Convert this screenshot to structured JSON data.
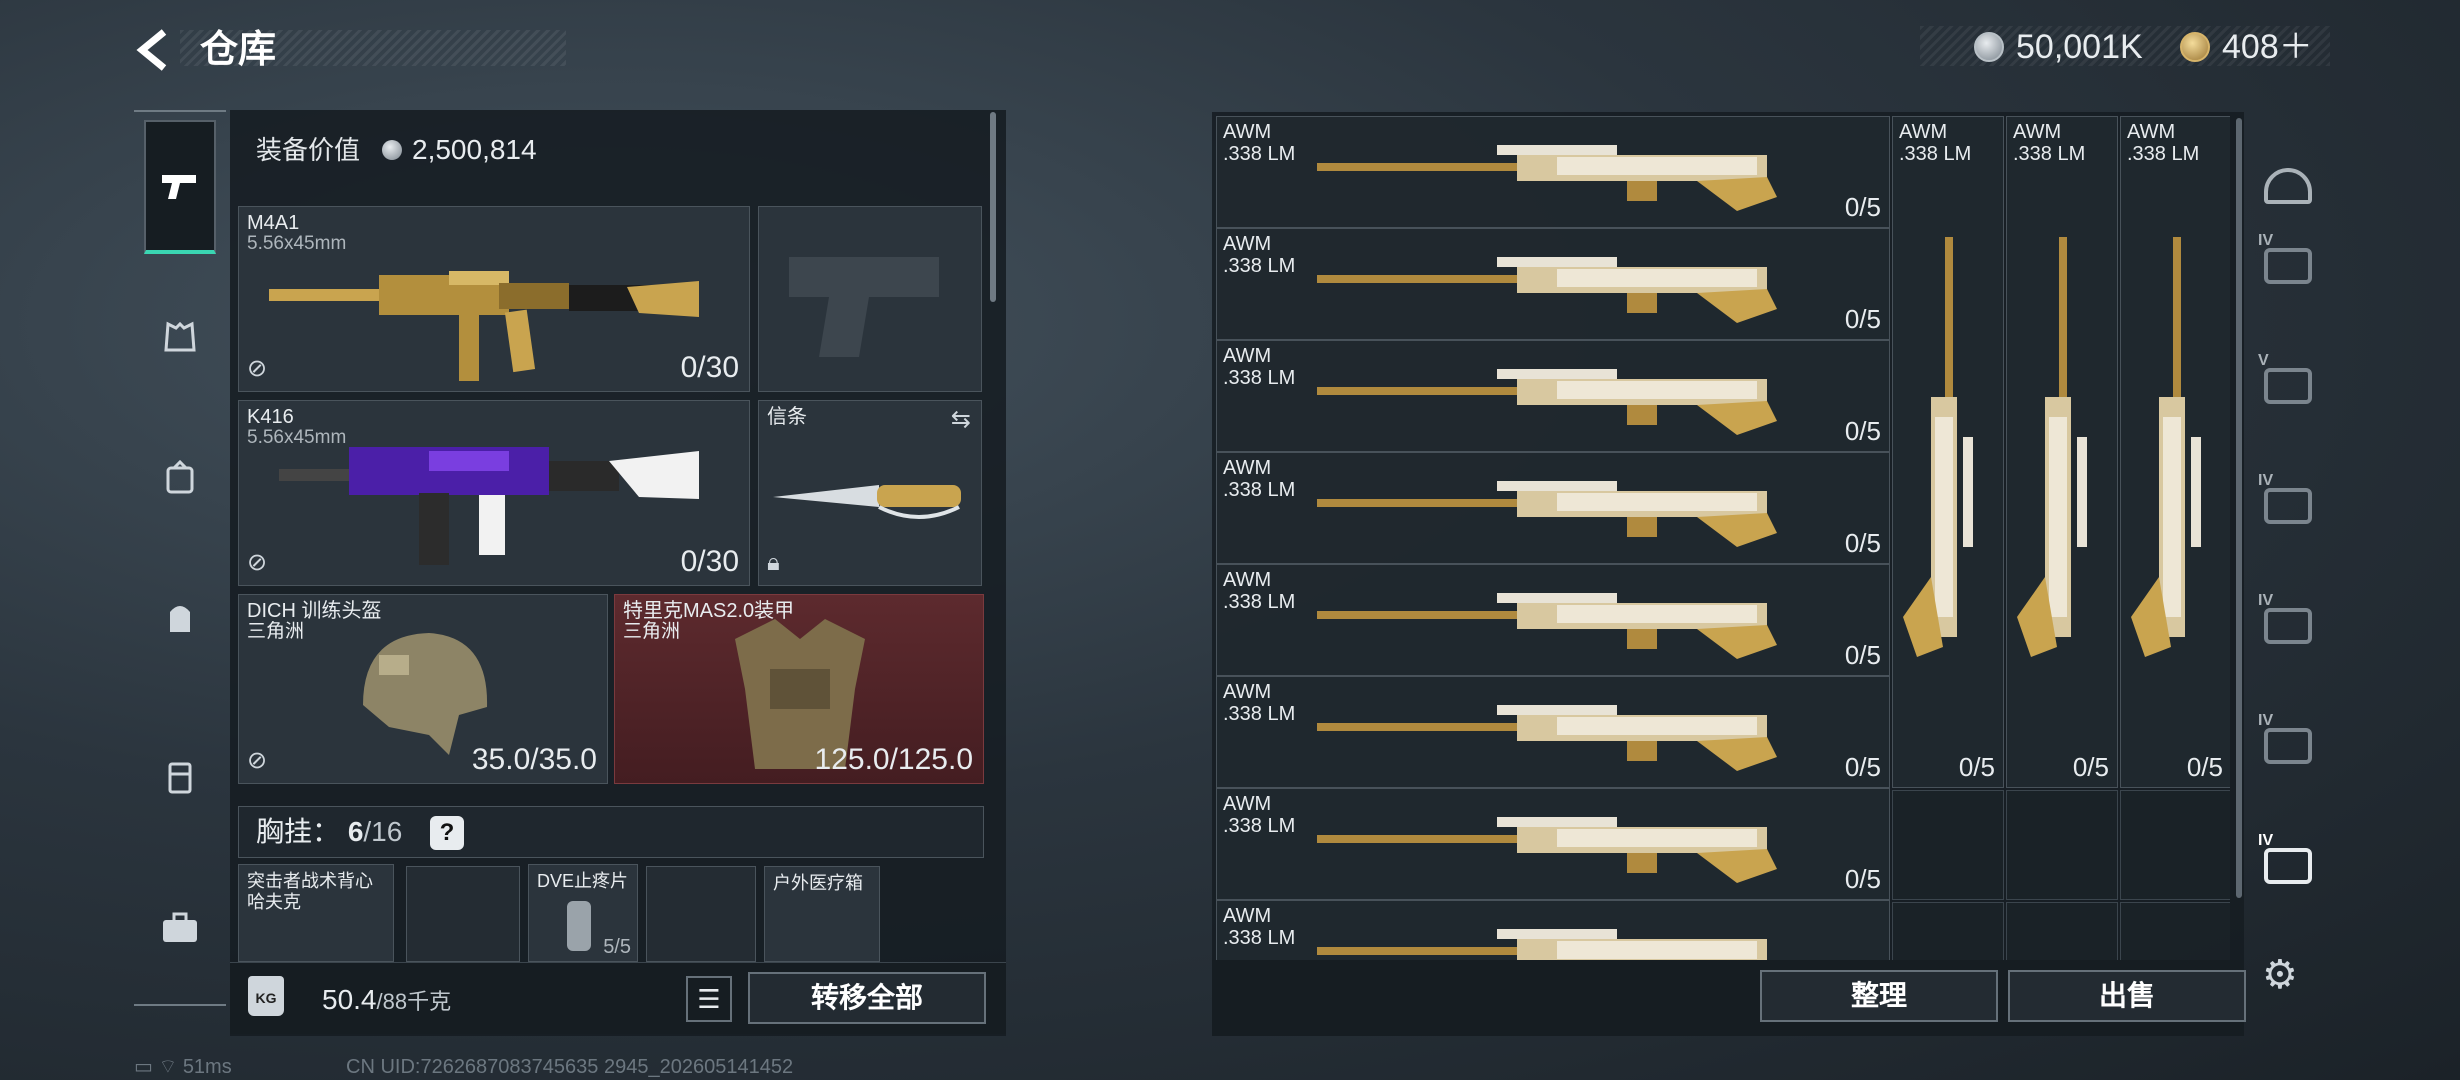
{
  "header": {
    "title": "仓库",
    "silver": "50,001K",
    "gold": "408＋"
  },
  "equipment": {
    "value_label": "装备价值",
    "value": "2,500,814",
    "primary": {
      "name": "M4A1",
      "caliber": "5.56x45mm",
      "ammo": "0/30"
    },
    "secondary": {
      "name": "K416",
      "caliber": "5.56x45mm",
      "ammo": "0/30"
    },
    "melee": {
      "name": "信条"
    },
    "helmet": {
      "name": "DICH 训练头盔",
      "faction": "三角洲",
      "durability": "35.0/35.0"
    },
    "armor": {
      "name": "特里克MAS2.0装甲",
      "faction": "三角洲",
      "durability": "125.0/125.0"
    },
    "chest_rig": {
      "label": "胸挂",
      "count": "6",
      "capacity": "/16",
      "help": "?"
    },
    "items": [
      {
        "name": "突击者战术背心",
        "sub": "哈夫克"
      },
      {
        "name": "DVE止疼片",
        "count": "5/5"
      },
      {
        "name": "户外医疗箱"
      }
    ]
  },
  "bottom_left": {
    "weight": "50.4",
    "weight_max": "/88千克",
    "transfer_label": "转移全部",
    "kg_label": "KG"
  },
  "stash": {
    "items": [
      {
        "name": "AWM",
        "caliber": ".338 LM",
        "ammo": "0/5"
      },
      {
        "name": "AWM",
        "caliber": ".338 LM",
        "ammo": "0/5"
      },
      {
        "name": "AWM",
        "caliber": ".338 LM",
        "ammo": "0/5"
      },
      {
        "name": "AWM",
        "caliber": ".338 LM",
        "ammo": "0/5"
      },
      {
        "name": "AWM",
        "caliber": ".338 LM",
        "ammo": "0/5"
      },
      {
        "name": "AWM",
        "caliber": ".338 LM",
        "ammo": "0/5"
      },
      {
        "name": "AWM",
        "caliber": ".338 LM",
        "ammo": "0/5"
      },
      {
        "name": "AWM",
        "caliber": ".338 LM"
      }
    ],
    "vertical": [
      {
        "name": "AWM",
        "caliber": ".338 LM",
        "ammo": "0/5"
      },
      {
        "name": "AWM",
        "caliber": ".338 LM",
        "ammo": "0/5"
      },
      {
        "name": "AWM",
        "caliber": ".338 LM",
        "ammo": "0/5"
      }
    ],
    "sort_label": "整理",
    "sell_label": "出售"
  },
  "right_nav": {
    "tags": [
      "IV",
      "V",
      "IV",
      "IV",
      "IV",
      "IV"
    ]
  },
  "status": {
    "ping": "51ms",
    "uid": "CN UID:7262687083745635 2945_202605141452"
  }
}
